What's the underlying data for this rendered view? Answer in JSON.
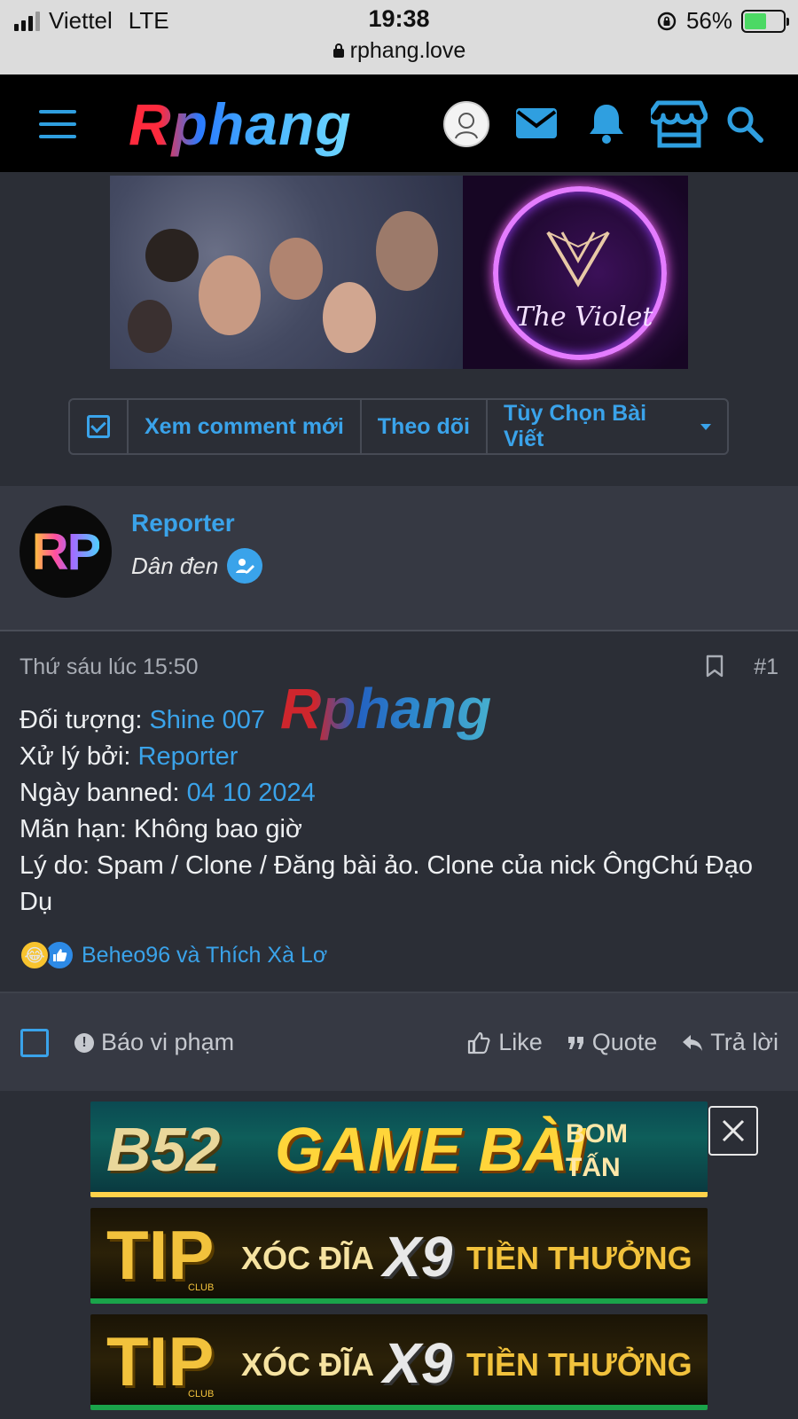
{
  "status_bar": {
    "carrier": "Viettel",
    "network": "LTE",
    "time": "19:38",
    "url": "rphang.love",
    "battery": "56%",
    "battery_level": 0.56
  },
  "header": {
    "logo": "Rphang"
  },
  "banner": {
    "brand_text": "The Violet"
  },
  "actions": {
    "new_comments": "Xem comment mới",
    "follow": "Theo dõi",
    "post_options": "Tùy Chọn Bài Viết"
  },
  "post": {
    "author": {
      "avatar_text": "RP",
      "name": "Reporter",
      "title": "Dân đen"
    },
    "date": "Thứ sáu lúc 15:50",
    "number": "#1",
    "watermark": "Rphang",
    "lines": [
      {
        "label": "Đối tượng: ",
        "value": "Shine 007"
      },
      {
        "label": "Xử lý bởi: ",
        "value": "Reporter"
      },
      {
        "label": "Ngày banned: ",
        "value": "04 10 2024"
      },
      {
        "label": "Mãn hạn: Không bao giờ",
        "value": ""
      },
      {
        "label": "Lý do: Spam / Clone / Đăng bài ảo. Clone của nick ÔngChú Đạo Dụ",
        "value": ""
      }
    ],
    "reactions_text": "Beheo96 và Thích Xà Lơ",
    "report": "Báo vi phạm",
    "like": "Like",
    "quote": "Quote",
    "reply": "Trả lời"
  },
  "ads": {
    "ad1": {
      "brand": "B52",
      "headline": "GAME BÀI",
      "sub1": "BOM",
      "sub2": "TẤN"
    },
    "ad2": {
      "brand": "TIP",
      "club": "CLUB",
      "t1": "XÓC ĐĨA",
      "t2": "X9",
      "t3": "TIỀN THƯỞNG"
    },
    "ad3": {
      "brand": "TIP",
      "club": "CLUB",
      "t1": "XÓC ĐĨA",
      "t2": "X9",
      "t3": "TIỀN THƯỞNG"
    }
  },
  "colors": {
    "accent": "#3aa3ea",
    "background": "#2b2e36",
    "panel": "#363943"
  }
}
